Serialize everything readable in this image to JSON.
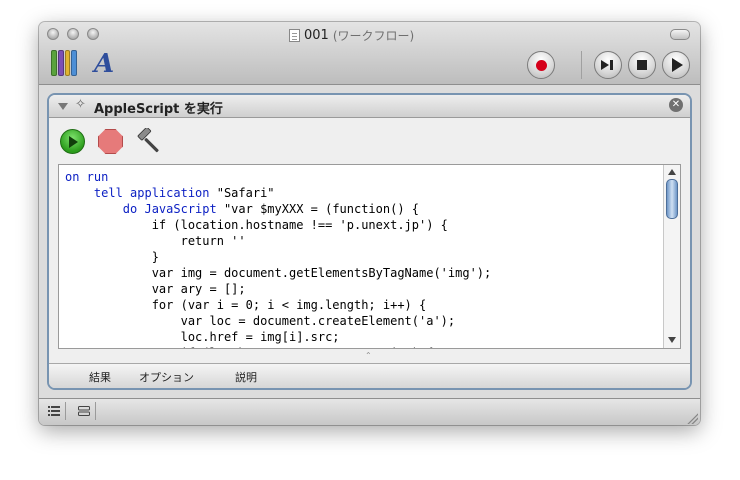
{
  "window": {
    "title": "001",
    "subtitle": "(ワークフロー)"
  },
  "toolbar": {
    "library_icon": "library-books-icon",
    "media_icon": "font-a-icon",
    "font_glyph": "A",
    "record_icon": "record-icon",
    "step_icon": "step-icon",
    "stop_icon": "stop-icon",
    "run_icon": "play-icon"
  },
  "action": {
    "title": "AppleScript を実行",
    "run_icon": "run-icon",
    "stop_icon": "stop-icon",
    "compile_icon": "hammer-icon",
    "code_lines": [
      [
        "kw:on run"
      ],
      [
        "    ",
        "kw:tell application",
        " \"Safari\""
      ],
      [
        "        ",
        "kw:do JavaScript",
        " \"var $myXXX = (function() {"
      ],
      [
        "            if (location.hostname !== 'p.unext.jp') {"
      ],
      [
        "                return ''"
      ],
      [
        "            }"
      ],
      [
        "            var img = document.getElementsByTagName('img');"
      ],
      [
        "            var ary = [];"
      ],
      [
        "            for (var i = 0; i < img.length; i++) {"
      ],
      [
        "                var loc = document.createElement('a');"
      ],
      [
        "                loc.href = img[i].src;"
      ],
      [
        "                if (loc.hostname == 'p.unext.jp') {"
      ]
    ]
  },
  "tabs": [
    "結果",
    "オプション",
    "説明"
  ],
  "bottom_bar": {
    "list_view_icon": "list-view-icon",
    "log_view_icon": "log-view-icon"
  }
}
